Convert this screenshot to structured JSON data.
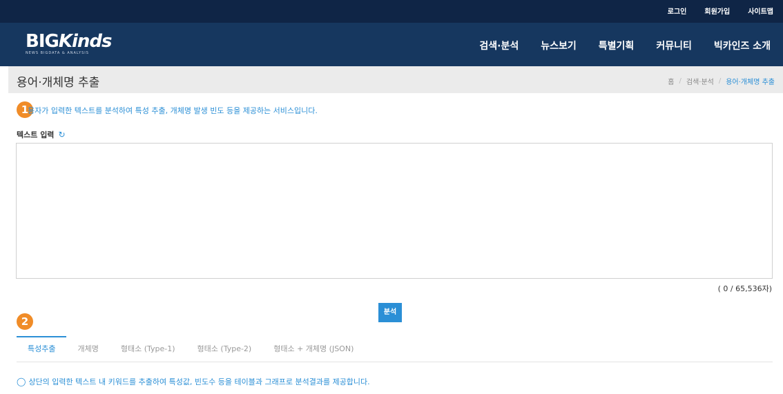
{
  "topbar": {
    "links": [
      "로그인",
      "회원가입",
      "사이트맵"
    ]
  },
  "logo": {
    "main_a": "BIG",
    "main_b": "Kinds",
    "sub": "NEWS BIGDATA & ANALYSIS"
  },
  "nav": {
    "items": [
      "검색·분석",
      "뉴스보기",
      "특별기획",
      "커뮤니티",
      "빅카인즈 소개"
    ]
  },
  "page": {
    "title": "용어·개체명 추출",
    "breadcrumb": {
      "home": "홈",
      "section": "검색·분석",
      "current": "용어·개체명 추출"
    }
  },
  "badges": [
    "1",
    "2"
  ],
  "content": {
    "description": "용자가 입력한 텍스트를 분석하여 특성 추출, 개체명 발생 빈도 등을 제공하는 서비스입니다.",
    "input_label": "텍스트 입력",
    "text_value": "",
    "counter": "( 0 / 65,536자)",
    "analyze_label": "분석"
  },
  "tabs": [
    "특성추출",
    "개체명",
    "형태소 (Type-1)",
    "형태소 (Type-2)",
    "형태소 + 개체명 (JSON)"
  ],
  "note": "상단의 입력한 텍스트 내 키워드를 추출하여 특성값, 빈도수 등을 테이블과 그래프로 분석결과를 제공합니다.",
  "colors": {
    "topbar": "#0f2546",
    "navbar": "#16375f",
    "accent": "#2b8fd6",
    "badge": "#f08c28"
  }
}
